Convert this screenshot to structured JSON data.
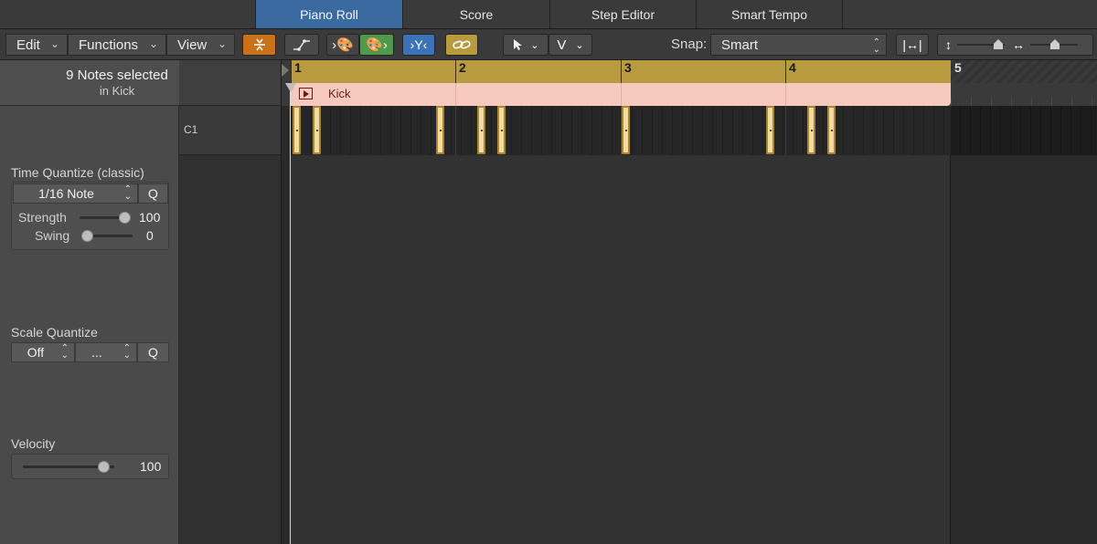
{
  "tabs": [
    {
      "label": "Piano Roll",
      "active": true
    },
    {
      "label": "Score",
      "active": false
    },
    {
      "label": "Step Editor",
      "active": false
    },
    {
      "label": "Smart Tempo",
      "active": false
    }
  ],
  "toolbar": {
    "menus": [
      "Edit",
      "Functions",
      "View"
    ],
    "snap_label": "Snap:",
    "snap_value": "Smart",
    "tool_v": "V",
    "colors": {
      "orange": "#c8721c",
      "blue": "#3b73b6",
      "green": "#4f9a4a",
      "gold": "#b89a3f"
    }
  },
  "inspector": {
    "selection_title": "9 Notes selected",
    "selection_subtitle": "in Kick",
    "time_quantize": {
      "label": "Time Quantize (classic)",
      "value": "1/16 Note",
      "q_button": "Q",
      "strength_label": "Strength",
      "strength_value": "100",
      "swing_label": "Swing",
      "swing_value": "0"
    },
    "scale_quantize": {
      "label": "Scale Quantize",
      "value1": "Off",
      "value2": "...",
      "q_button": "Q"
    },
    "velocity": {
      "label": "Velocity",
      "value": "100"
    }
  },
  "keys": {
    "note_label": "C1"
  },
  "ruler": {
    "bars": [
      "1",
      "2",
      "3",
      "4",
      "5"
    ]
  },
  "region": {
    "name": "Kick",
    "color": "#f6c9be"
  }
}
